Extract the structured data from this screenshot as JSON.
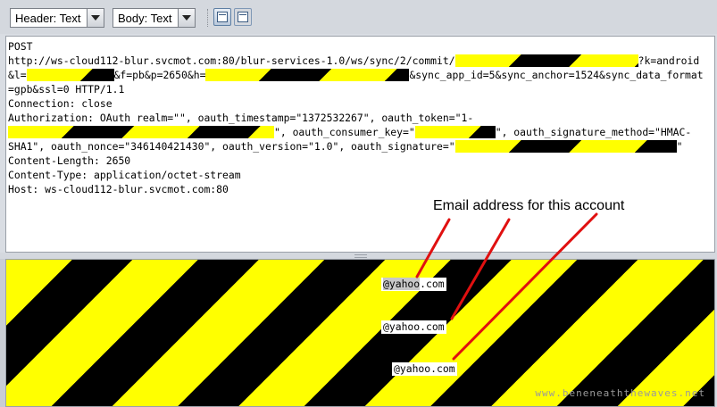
{
  "toolbar": {
    "header_select": "Header: Text",
    "body_select": "Body: Text",
    "view_buttons": [
      "split-view-icon",
      "single-view-icon"
    ]
  },
  "request": {
    "method": "POST",
    "url_part1": "http://ws-cloud112-blur.svcmot.com:80/blur-services-1.0/ws/sync/2/commit/",
    "url_part2": "?k=android",
    "line3_a": "&l=",
    "line3_b": "&f=pb&p=2650&h=",
    "line3_c": "&sync_app_id=5&sync_anchor=1524&sync_data_format",
    "line4": "=gpb&ssl=0 HTTP/1.1",
    "connection": "Connection: close",
    "auth_line1": "Authorization: OAuth realm=\"\", oauth_timestamp=\"1372532267\", oauth_token=\"1-",
    "auth_line2_b": "\", oauth_consumer_key=\"",
    "auth_line2_d": "\", oauth_signature_method=\"HMAC-",
    "auth_line3_a": "SHA1\", oauth_nonce=\"346140421430\", oauth_version=\"1.0\", oauth_signature=\"",
    "auth_line3_c": "\"",
    "content_length": "Content-Length: 2650",
    "content_type": "Content-Type: application/octet-stream",
    "host": "Host: ws-cloud112-blur.svcmot.com:80"
  },
  "annotation": {
    "label": "Email address for this account",
    "color": "#e01010"
  },
  "response": {
    "emails": [
      {
        "highlight": "@yahoo",
        "rest": ".com"
      },
      {
        "highlight": "",
        "rest": "@yahoo.com"
      },
      {
        "highlight": "",
        "rest": "@yahoo.com"
      }
    ]
  },
  "watermark": "www.beneneaththewaves.net",
  "colors": {
    "hazard_yellow": "#ffff00",
    "hazard_black": "#000000"
  }
}
